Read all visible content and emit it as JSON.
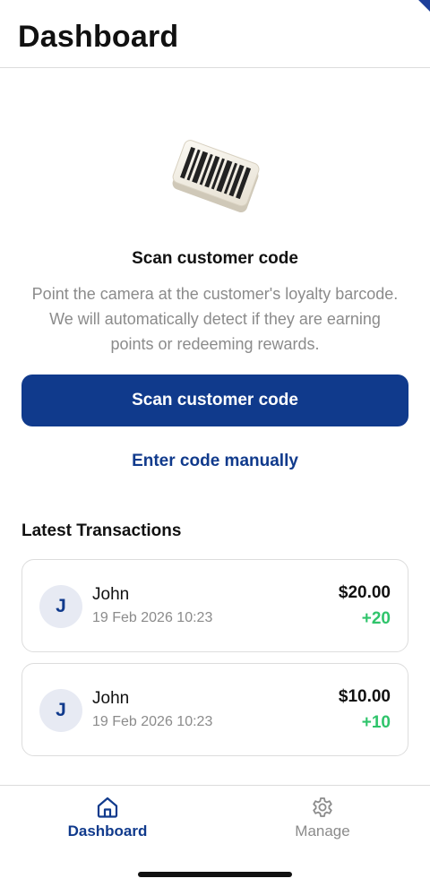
{
  "header": {
    "title": "Dashboard"
  },
  "scan": {
    "heading": "Scan customer code",
    "description": "Point the camera at the customer's loyalty barcode. We will automatically detect if they are earning points or redeeming rewards.",
    "button_label": "Scan customer code",
    "manual_link": "Enter code manually",
    "illustration_icon": "barcode-card-icon"
  },
  "transactions": {
    "title": "Latest Transactions",
    "items": [
      {
        "initial": "J",
        "name": "John",
        "date": "19 Feb 2026 10:23",
        "amount": "$20.00",
        "points": "+20"
      },
      {
        "initial": "J",
        "name": "John",
        "date": "19 Feb 2026 10:23",
        "amount": "$10.00",
        "points": "+10"
      }
    ]
  },
  "tabbar": {
    "tabs": [
      {
        "label": "Dashboard",
        "icon": "home-icon",
        "active": true
      },
      {
        "label": "Manage",
        "icon": "gear-icon",
        "active": false
      }
    ]
  },
  "colors": {
    "brand": "#103a8c",
    "points_positive": "#2fc46b",
    "muted_text": "#8b8b8b",
    "avatar_bg": "#e7eaf3"
  }
}
